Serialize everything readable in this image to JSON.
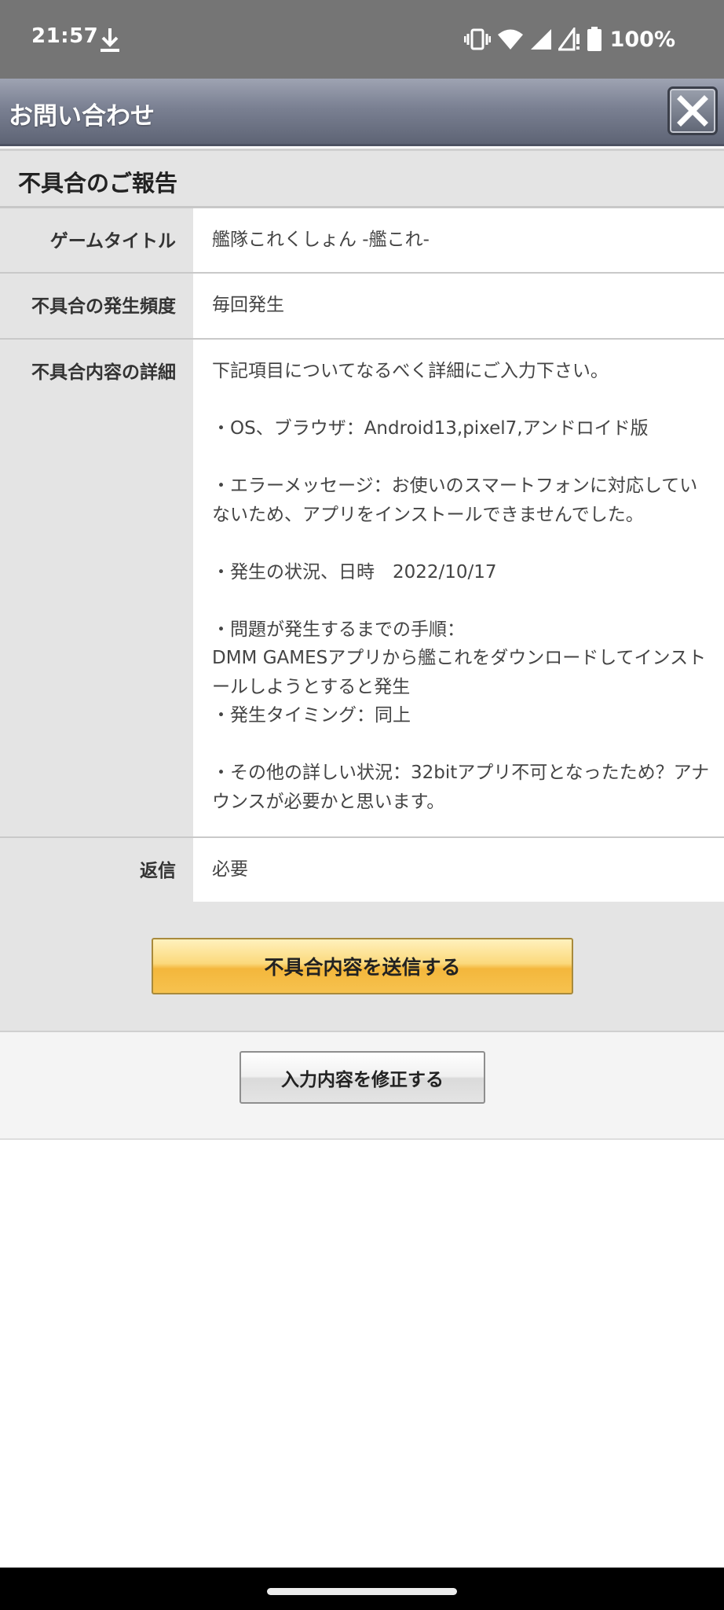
{
  "status_bar": {
    "time": "21:57",
    "battery": "100%",
    "icons": [
      "download-icon",
      "vibrate-icon",
      "wifi-icon",
      "signal-icon",
      "signal-alert-icon",
      "battery-icon"
    ]
  },
  "header": {
    "title": "お問い合わせ",
    "close_icon": "close-icon"
  },
  "section": {
    "heading": "不具合のご報告"
  },
  "rows": {
    "title": {
      "label": "ゲームタイトル",
      "value": "艦隊これくしょん -艦これ-"
    },
    "frequency": {
      "label": "不具合の発生頻度",
      "value": "毎回発生"
    },
    "detail": {
      "label": "不具合内容の詳細",
      "lines": [
        "下記項目についてなるべく詳細にご入力下さい。",
        "",
        "・OS、ブラウザ：Android13,pixel7,アンドロイド版",
        "",
        "・エラーメッセージ：お使いのスマートフォンに対応してい",
        "ないため、アプリをインストールできませんでした。",
        "",
        "・発生の状況、日時　2022/10/17",
        "",
        "・問題が発生するまでの手順：",
        "DMM GAMESアプリから艦これをダウンロードしてインスト",
        "ールしようとすると発生",
        "・発生タイミング：同上",
        "",
        "・その他の詳しい状況：32bitアプリ不可となったため？アナ",
        "ウンスが必要かと思います。"
      ]
    },
    "reply": {
      "label": "返信",
      "value": "必要"
    }
  },
  "buttons": {
    "submit": "不具合内容を送信する",
    "edit": "入力内容を修正する"
  },
  "colors": {
    "status_bar": "#757575",
    "header": "#7a8092",
    "label_bg": "#e4e4e4",
    "submit_button": "#f6c24f"
  }
}
